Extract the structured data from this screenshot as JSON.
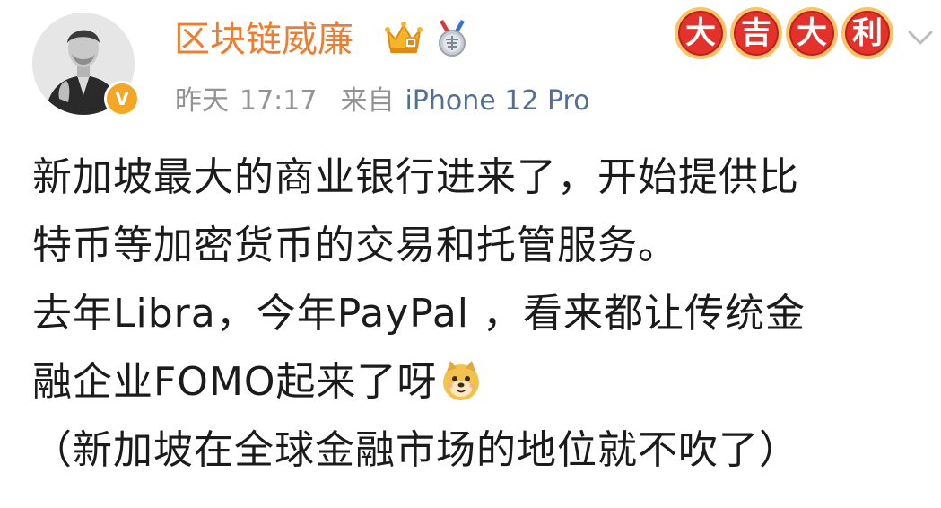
{
  "author": {
    "name": "区块链威廉",
    "verified_mark": "V",
    "icons": [
      "crown-icon",
      "medal-icon"
    ]
  },
  "meta": {
    "date": "昨天",
    "time": "17:17",
    "source_prefix": "来自",
    "device": "iPhone 12 Pro"
  },
  "decoration": {
    "chars": [
      "大",
      "吉",
      "大",
      "利"
    ]
  },
  "post": {
    "lines": [
      "新加坡最大的商业银行进来了，开始提供比",
      "特币等加密货币的交易和托管服务。",
      "去年Libra，今年PayPal ，看来都让传统金",
      "融企业FOMO起来了呀",
      "（新加坡在全球金融市场的地位就不吹了）"
    ],
    "emoji": "doge-icon"
  },
  "colors": {
    "name": "#f07c31",
    "meta_gray": "#939393",
    "device_link": "#526f97",
    "text": "#1b1b1b",
    "badge": "#f5a623",
    "fortune_red": "#e3322b"
  }
}
